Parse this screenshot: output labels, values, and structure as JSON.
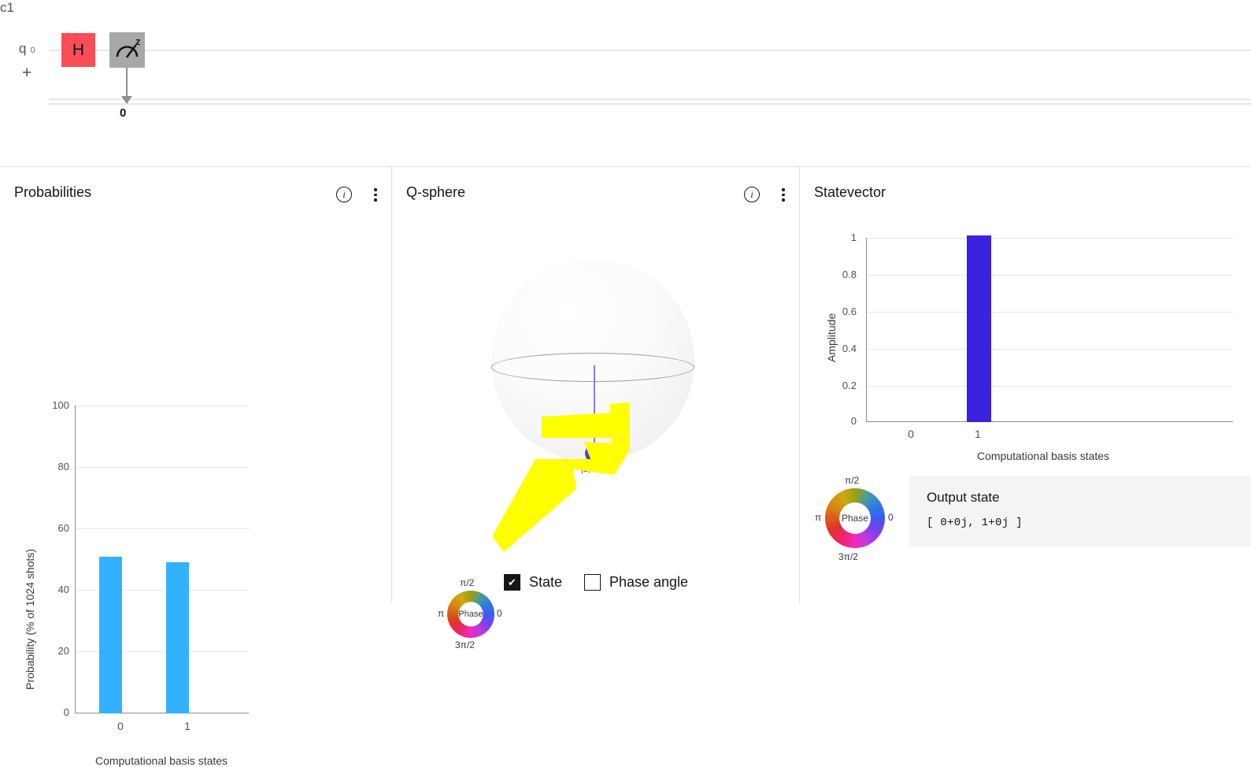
{
  "circuit": {
    "qubit_label": "q",
    "qubit_index": "0",
    "add_qubit_label": "+",
    "classical_register_label": "c1",
    "measure_bit_label": "0",
    "gates": [
      {
        "name": "hadamard-gate",
        "label": "H",
        "color": "#fa4d56"
      },
      {
        "name": "measure-z-gate",
        "label": "z",
        "color": "#a8a8a8"
      }
    ]
  },
  "panels": {
    "probabilities": {
      "title": "Probabilities",
      "info_icon": "info-icon",
      "menu_icon": "overflow-menu-icon"
    },
    "qsphere": {
      "title": "Q-sphere",
      "info_icon": "info-icon",
      "menu_icon": "overflow-menu-icon",
      "state_node_label": "|1⟩",
      "toggles": [
        {
          "label": "State",
          "checked": true
        },
        {
          "label": "Phase angle",
          "checked": false
        }
      ],
      "phase_legend": {
        "center": "Phase",
        "top": "π/2",
        "right": "0",
        "left": "π",
        "bottom": "3π/2"
      }
    },
    "statevector": {
      "title": "Statevector",
      "phase_legend": {
        "center": "Phase",
        "top": "π/2",
        "right": "0",
        "left": "π",
        "bottom": "3π/2"
      },
      "output_state_title": "Output state",
      "output_state_value": "[ 0+0j, 1+0j ]"
    }
  },
  "chart_data": [
    {
      "type": "bar",
      "name": "probabilities-chart",
      "title": "Probabilities",
      "categories": [
        "0",
        "1"
      ],
      "values": [
        51,
        49
      ],
      "xlabel": "Computational basis states",
      "ylabel": "Probability (% of 1024 shots)",
      "ylim": [
        0,
        100
      ],
      "yticks": [
        0,
        20,
        40,
        60,
        80,
        100
      ],
      "bar_color": "#33b1ff",
      "grid": true,
      "legend": "none"
    },
    {
      "type": "bar",
      "name": "statevector-chart",
      "title": "Statevector",
      "categories": [
        "0",
        "1"
      ],
      "values": [
        0,
        1
      ],
      "xlabel": "Computational basis states",
      "ylabel": "Amplitude",
      "ylim": [
        0,
        1
      ],
      "yticks": [
        0,
        0.2,
        0.4,
        0.6,
        0.8,
        1
      ],
      "bar_color": "#3b22e0",
      "grid": true,
      "legend": "none"
    }
  ]
}
